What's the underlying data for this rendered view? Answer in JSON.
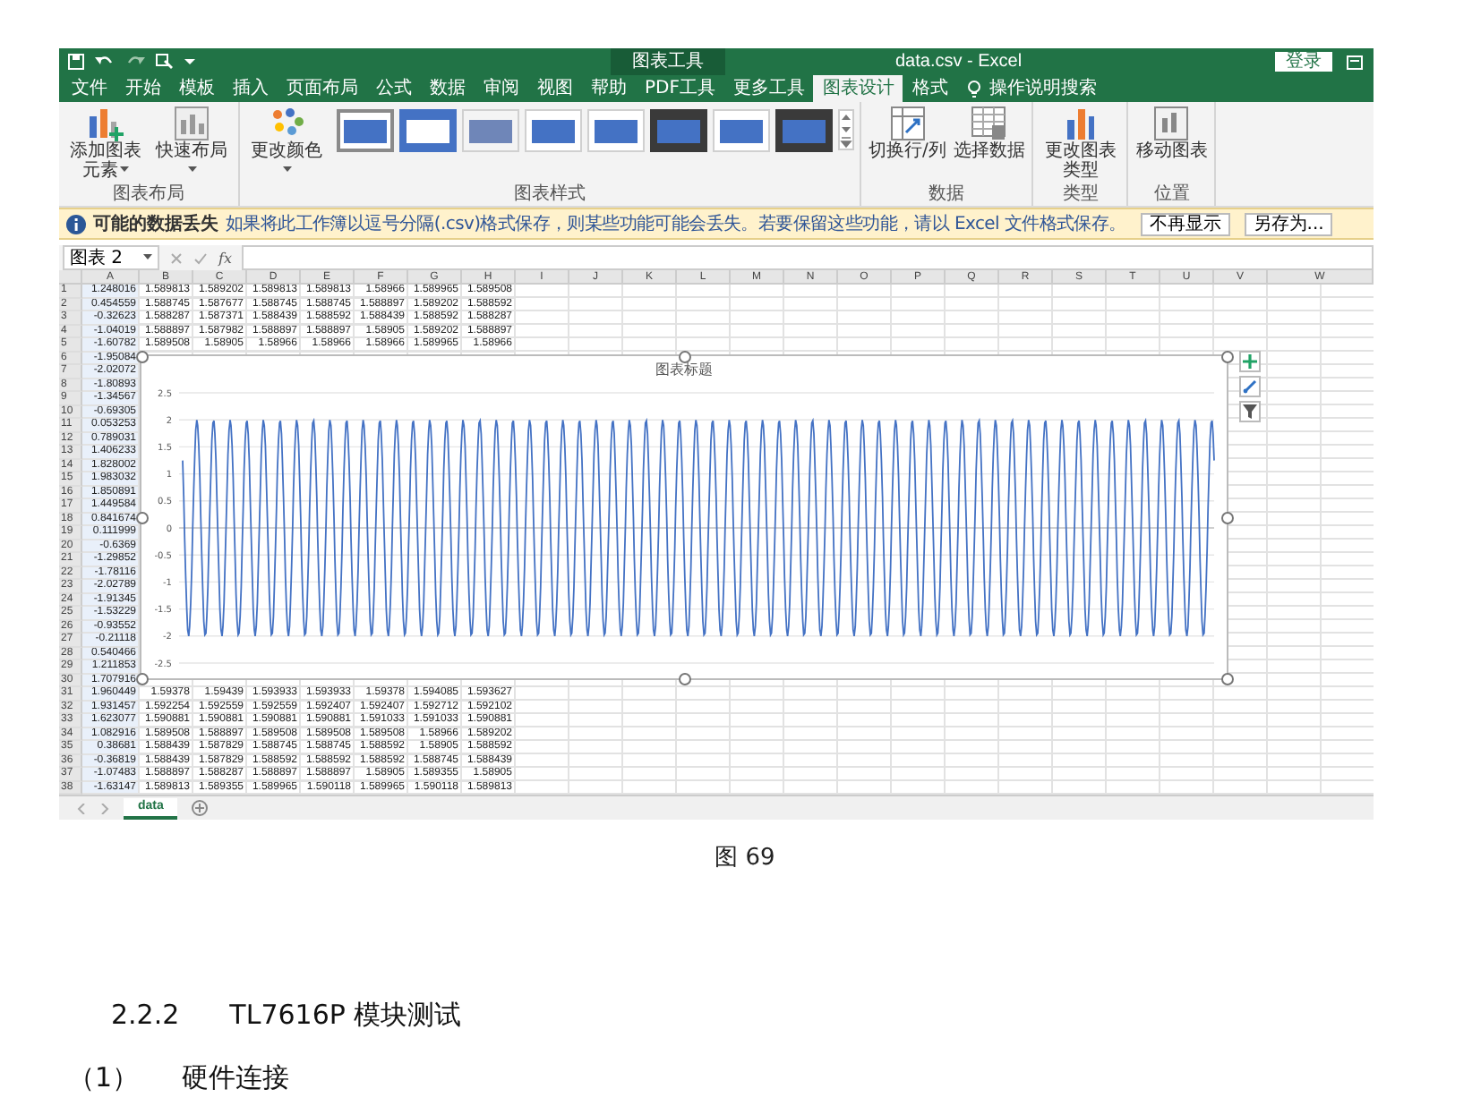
{
  "title_bar": {
    "context_label": "图表工具",
    "title": "data.csv  -  Excel",
    "sign_in": "登录"
  },
  "tabs": [
    {
      "label": "文件",
      "selected": false
    },
    {
      "label": "开始",
      "selected": false
    },
    {
      "label": "模板",
      "selected": false
    },
    {
      "label": "插入",
      "selected": false
    },
    {
      "label": "页面布局",
      "selected": false
    },
    {
      "label": "公式",
      "selected": false
    },
    {
      "label": "数据",
      "selected": false
    },
    {
      "label": "审阅",
      "selected": false
    },
    {
      "label": "视图",
      "selected": false
    },
    {
      "label": "帮助",
      "selected": false
    },
    {
      "label": "PDF工具",
      "selected": false
    },
    {
      "label": "更多工具",
      "selected": false
    },
    {
      "label": "图表设计",
      "selected": true
    },
    {
      "label": "格式",
      "selected": false
    }
  ],
  "tell_me": "操作说明搜索",
  "ribbon": {
    "groups": [
      {
        "label": "图表布局",
        "buttons": [
          {
            "label": "添加图表元素",
            "dropdown": true
          },
          {
            "label": "快速布局",
            "dropdown": true
          }
        ]
      },
      {
        "label": "图表样式",
        "buttons": [
          {
            "label": "更改颜色",
            "dropdown": true
          }
        ],
        "styles": [
          {
            "kind": "plain",
            "selected": true
          },
          {
            "kind": "outline",
            "selected": false
          },
          {
            "kind": "muted",
            "selected": false
          },
          {
            "kind": "plain",
            "selected": false
          },
          {
            "kind": "plain",
            "selected": false
          },
          {
            "kind": "dark",
            "selected": false
          },
          {
            "kind": "plain",
            "selected": false
          },
          {
            "kind": "dark",
            "selected": false
          }
        ]
      },
      {
        "label": "数据",
        "buttons": [
          {
            "label": "切换行/列",
            "dropdown": false
          },
          {
            "label": "选择数据",
            "dropdown": false
          }
        ]
      },
      {
        "label": "类型",
        "buttons": [
          {
            "label": "更改图表类型",
            "dropdown": false
          }
        ]
      },
      {
        "label": "位置",
        "buttons": [
          {
            "label": "移动图表",
            "dropdown": false
          }
        ]
      }
    ]
  },
  "info_bar": {
    "label": "可能的数据丢失",
    "message": "如果将此工作簿以逗号分隔(.csv)格式保存，则某些功能可能会丢失。若要保留这些功能，请以 Excel 文件格式保存。",
    "buttons": [
      "不再显示",
      "另存为..."
    ]
  },
  "formula_bar": {
    "name_box": "图表 2",
    "function": "fx"
  },
  "sheet": {
    "columns": [
      "A",
      "B",
      "C",
      "D",
      "E",
      "F",
      "G",
      "H",
      "I",
      "J",
      "K",
      "L",
      "M",
      "N",
      "O",
      "P",
      "Q",
      "R",
      "S",
      "T",
      "U",
      "V",
      "W"
    ],
    "rows": [
      {
        "number": "1",
        "cells": [
          "1.248016",
          "1.589813",
          "1.589202",
          "1.589813",
          "1.589813",
          "1.58966",
          "1.589965",
          "1.589508"
        ]
      },
      {
        "number": "2",
        "cells": [
          "0.454559",
          "1.588745",
          "1.587677",
          "1.588745",
          "1.588745",
          "1.588897",
          "1.589202",
          "1.588592"
        ]
      },
      {
        "number": "3",
        "cells": [
          "-0.32623",
          "1.588287",
          "1.587371",
          "1.588439",
          "1.588592",
          "1.588439",
          "1.588592",
          "1.588287"
        ]
      },
      {
        "number": "4",
        "cells": [
          "-1.04019",
          "1.588897",
          "1.587982",
          "1.588897",
          "1.588897",
          "1.58905",
          "1.589202",
          "1.588897"
        ]
      },
      {
        "number": "5",
        "cells": [
          "-1.60782",
          "1.589508",
          "1.58905",
          "1.58966",
          "1.58966",
          "1.58966",
          "1.589965",
          "1.58966"
        ]
      },
      {
        "number": "6",
        "cells": [
          "-1.95084"
        ]
      },
      {
        "number": "7",
        "cells": [
          "-2.02072"
        ]
      },
      {
        "number": "8",
        "cells": [
          "-1.80893"
        ]
      },
      {
        "number": "9",
        "cells": [
          "-1.34567"
        ]
      },
      {
        "number": "10",
        "cells": [
          "-0.69305"
        ]
      },
      {
        "number": "11",
        "cells": [
          "0.053253"
        ]
      },
      {
        "number": "12",
        "cells": [
          "0.789031"
        ]
      },
      {
        "number": "13",
        "cells": [
          "1.406233"
        ]
      },
      {
        "number": "14",
        "cells": [
          "1.828002"
        ]
      },
      {
        "number": "15",
        "cells": [
          "1.983032"
        ]
      },
      {
        "number": "16",
        "cells": [
          "1.850891"
        ]
      },
      {
        "number": "17",
        "cells": [
          "1.449584"
        ]
      },
      {
        "number": "18",
        "cells": [
          "0.841674"
        ]
      },
      {
        "number": "19",
        "cells": [
          "0.111999"
        ]
      },
      {
        "number": "20",
        "cells": [
          "-0.6369"
        ]
      },
      {
        "number": "21",
        "cells": [
          "-1.29852"
        ]
      },
      {
        "number": "22",
        "cells": [
          "-1.78116"
        ]
      },
      {
        "number": "23",
        "cells": [
          "-2.02789"
        ]
      },
      {
        "number": "24",
        "cells": [
          "-1.91345"
        ]
      },
      {
        "number": "25",
        "cells": [
          "-1.53229"
        ]
      },
      {
        "number": "26",
        "cells": [
          "-0.93552"
        ]
      },
      {
        "number": "27",
        "cells": [
          "-0.21118"
        ]
      },
      {
        "number": "28",
        "cells": [
          "0.540466"
        ]
      },
      {
        "number": "29",
        "cells": [
          "1.211853"
        ]
      },
      {
        "number": "30",
        "cells": [
          "1.707916"
        ]
      },
      {
        "number": "31",
        "cells": [
          "1.960449",
          "1.59378",
          "1.59439",
          "1.593933",
          "1.593933",
          "1.59378",
          "1.594085",
          "1.593627"
        ]
      },
      {
        "number": "32",
        "cells": [
          "1.931457",
          "1.592254",
          "1.592559",
          "1.592559",
          "1.592407",
          "1.592407",
          "1.592712",
          "1.592102"
        ]
      },
      {
        "number": "33",
        "cells": [
          "1.623077",
          "1.590881",
          "1.590881",
          "1.590881",
          "1.590881",
          "1.591033",
          "1.591033",
          "1.590881"
        ]
      },
      {
        "number": "34",
        "cells": [
          "1.082916",
          "1.589508",
          "1.588897",
          "1.589508",
          "1.589508",
          "1.589508",
          "1.58966",
          "1.589202"
        ]
      },
      {
        "number": "35",
        "cells": [
          "0.38681",
          "1.588439",
          "1.587829",
          "1.588745",
          "1.588745",
          "1.588592",
          "1.58905",
          "1.588592"
        ]
      },
      {
        "number": "36",
        "cells": [
          "-0.36819",
          "1.588439",
          "1.587829",
          "1.588592",
          "1.588592",
          "1.588592",
          "1.588745",
          "1.588439"
        ]
      },
      {
        "number": "37",
        "cells": [
          "-1.07483",
          "1.588897",
          "1.588287",
          "1.588897",
          "1.588897",
          "1.58905",
          "1.589355",
          "1.58905"
        ]
      },
      {
        "number": "38",
        "cells": [
          "-1.63147",
          "1.589813",
          "1.589355",
          "1.589965",
          "1.590118",
          "1.589965",
          "1.590118",
          "1.589813"
        ]
      }
    ]
  },
  "chart": {
    "title": "图表标题",
    "y_axis_labels": [
      "2.5",
      "2",
      "1.5",
      "1",
      "0.5",
      "0",
      "-0.5",
      "-1",
      "-1.5",
      "-2",
      "-2.5"
    ]
  },
  "sheet_tabs": [
    {
      "label": "data",
      "selected": true
    }
  ],
  "document": {
    "figure_caption": "图 69",
    "heading": {
      "number": "2.2.2",
      "text": "TL7616P 模块测试"
    },
    "subheading": {
      "number": "（1）",
      "text": "硬件连接"
    }
  }
}
